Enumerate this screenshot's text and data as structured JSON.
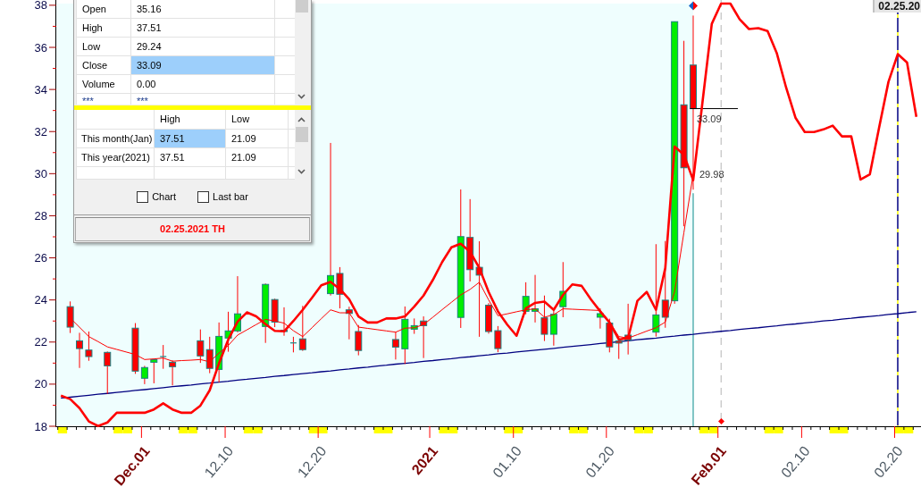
{
  "chart": {
    "chart_data": {
      "type": "candlestick",
      "ylim": [
        18,
        38.25
      ],
      "yticks": [
        18,
        20,
        22,
        24,
        26,
        28,
        30,
        32,
        34,
        36,
        38
      ],
      "categories": [
        null,
        null,
        null,
        null,
        null,
        null,
        null,
        null,
        null,
        "Dec.01",
        null,
        null,
        null,
        null,
        null,
        null,
        null,
        null,
        "12.10",
        null,
        null,
        null,
        null,
        null,
        null,
        null,
        null,
        null,
        "12.20",
        null,
        null,
        null,
        null,
        null,
        null,
        null,
        null,
        null,
        null,
        null,
        "2021",
        null,
        null,
        null,
        null,
        null,
        null,
        null,
        null,
        "01.10",
        null,
        null,
        null,
        null,
        null,
        null,
        null,
        null,
        null,
        "01.20",
        null,
        null,
        null,
        null,
        null,
        null,
        null,
        null,
        null,
        null,
        null,
        "Feb.01",
        null,
        null,
        null,
        null,
        null,
        null,
        null,
        null,
        "02.10",
        null,
        null,
        null,
        null,
        null,
        null,
        null,
        null,
        null,
        "02.20",
        null,
        null
      ],
      "ohlc": [
        null,
        [
          23.68,
          23.93,
          22.43,
          22.71
        ],
        [
          22.06,
          22.44,
          20.77,
          21.69
        ],
        [
          21.62,
          22.5,
          21.11,
          21.31
        ],
        null,
        [
          21.51,
          21.55,
          19.54,
          20.87
        ],
        null,
        null,
        [
          22.66,
          22.9,
          20.49,
          20.62
        ],
        [
          20.28,
          20.87,
          20.0,
          20.79
        ],
        [
          21.04,
          21.2,
          20.04,
          21.16
        ],
        [
          21.31,
          21.86,
          20.73,
          21.31
        ],
        [
          21.04,
          21.13,
          19.94,
          20.83
        ],
        null,
        null,
        [
          22.06,
          22.6,
          21.01,
          21.34
        ],
        [
          21.64,
          22.25,
          20.52,
          20.75
        ],
        [
          20.7,
          22.93,
          20.08,
          22.27
        ],
        [
          22.19,
          23.44,
          21.54,
          22.53
        ],
        [
          22.53,
          25.13,
          22.46,
          23.34
        ],
        null,
        null,
        [
          22.74,
          24.78,
          21.96,
          24.74
        ],
        [
          24.02,
          24.06,
          22.71,
          22.95
        ],
        [
          22.56,
          23.65,
          22.3,
          22.5
        ],
        [
          21.96,
          22.25,
          21.51,
          21.96
        ],
        [
          22.15,
          23.72,
          21.58,
          21.64
        ],
        null,
        null,
        [
          24.3,
          31.46,
          24.21,
          25.16
        ],
        [
          25.26,
          25.56,
          23.6,
          24.27
        ],
        [
          23.53,
          23.68,
          22.13,
          23.36
        ],
        [
          22.5,
          22.81,
          21.37,
          21.6
        ],
        null,
        null,
        null,
        [
          22.12,
          22.47,
          21.17,
          21.76
        ],
        [
          21.68,
          23.69,
          20.96,
          23.08
        ],
        [
          22.61,
          23.12,
          22.39,
          22.78
        ],
        [
          23.0,
          23.22,
          21.24,
          22.78
        ],
        null,
        null,
        null,
        [
          23.17,
          29.25,
          22.67,
          27.01
        ],
        [
          26.97,
          28.79,
          24.88,
          25.44
        ],
        [
          25.55,
          26.79,
          22.25,
          25.18
        ],
        [
          23.75,
          23.85,
          22.4,
          22.5
        ],
        [
          22.54,
          22.76,
          21.52,
          21.69
        ],
        null,
        null,
        [
          23.46,
          24.84,
          23.32,
          24.17
        ],
        [
          23.46,
          25.19,
          22.93,
          23.58
        ],
        [
          23.15,
          24.21,
          22.05,
          22.37
        ],
        [
          22.37,
          23.5,
          21.83,
          23.32
        ],
        [
          23.68,
          25.8,
          23.18,
          24.41
        ],
        null,
        null,
        null,
        [
          23.18,
          23.6,
          22.64,
          23.35
        ],
        [
          22.9,
          23.11,
          21.51,
          21.77
        ],
        [
          22.05,
          22.26,
          21.2,
          21.95
        ],
        [
          22.33,
          23.82,
          21.41,
          22.09
        ],
        null,
        null,
        [
          22.47,
          26.65,
          22.26,
          23.29
        ],
        [
          23.99,
          26.8,
          22.68,
          23.18
        ],
        [
          23.96,
          37.22,
          23.82,
          37.22
        ],
        [
          33.27,
          36.31,
          27.5,
          30.28
        ],
        [
          35.16,
          37.51,
          29.24,
          33.09
        ],
        null,
        null,
        null,
        null,
        null,
        null,
        null,
        null,
        null,
        null,
        null,
        null,
        null,
        null,
        null,
        null,
        null,
        null,
        null,
        null,
        null,
        null,
        null,
        null
      ],
      "series": [
        {
          "type": "line",
          "color": "#000080",
          "values": [
            19.34,
            19.38,
            19.43,
            19.47,
            19.52,
            19.56,
            19.61,
            19.65,
            19.7,
            19.74,
            19.79,
            19.83,
            19.88,
            19.92,
            19.96,
            20.01,
            20.05,
            20.1,
            20.14,
            20.19,
            20.23,
            20.28,
            20.32,
            20.37,
            20.41,
            20.46,
            20.5,
            20.54,
            20.59,
            20.63,
            20.68,
            20.72,
            20.77,
            20.81,
            20.86,
            20.9,
            20.95,
            20.99,
            21.03,
            21.08,
            21.12,
            21.17,
            21.21,
            21.26,
            21.3,
            21.35,
            21.39,
            21.44,
            21.48,
            21.53,
            21.57,
            21.61,
            21.66,
            21.7,
            21.75,
            21.79,
            21.84,
            21.88,
            21.93,
            21.97,
            22.02,
            22.06,
            22.11,
            22.15,
            22.19,
            22.24,
            22.28,
            22.33,
            22.37,
            22.42,
            22.46,
            22.51,
            22.55,
            22.6,
            22.64,
            22.68,
            22.73,
            22.77,
            22.82,
            22.86,
            22.91,
            22.95,
            23.0,
            23.04,
            23.09,
            23.13,
            23.18,
            23.22,
            23.26,
            23.31,
            23.35,
            23.4,
            23.44
          ]
        },
        {
          "type": "line",
          "color": "#ff0000",
          "values": [
            19.45,
            19.29,
            18.86,
            18.23,
            18.01,
            18.18,
            18.64,
            18.64,
            18.64,
            18.64,
            18.8,
            19.09,
            18.8,
            18.64,
            18.64,
            18.98,
            19.71,
            20.99,
            22.12,
            22.97,
            23.41,
            23.22,
            22.85,
            22.53,
            22.51,
            23.0,
            23.53,
            24.1,
            24.7,
            24.86,
            24.52,
            24.03,
            23.22,
            22.93,
            22.93,
            23.12,
            23.12,
            23.22,
            23.68,
            24.21,
            24.95,
            25.8,
            26.5,
            26.67,
            26.29,
            25.52,
            24.38,
            23.46,
            22.83,
            22.3,
            23.6,
            23.86,
            23.92,
            23.53,
            24.24,
            24.74,
            24.67,
            24.03,
            23.46,
            22.93,
            22.12,
            22.19,
            23.96,
            24.38,
            23.53,
            25.52,
            31.29,
            30.9,
            29.69,
            33.4,
            37.12,
            38.08,
            38.08,
            37.33,
            36.87,
            36.91,
            36.77,
            35.71,
            34.08,
            32.66,
            31.98,
            31.98,
            32.1,
            32.28,
            31.77,
            31.77,
            29.72,
            29.97,
            32.2,
            34.36,
            35.68,
            35.28,
            32.7
          ]
        },
        {
          "type": "line",
          "color": "#ff0000",
          "values": [
            null,
            23.14,
            22.7,
            22.26,
            22.02,
            21.77,
            21.65,
            21.53,
            21.41,
            21.17,
            21.2,
            21.24,
            21.09,
            21.12,
            21.14,
            21.17,
            21.06,
            21.48,
            21.84,
            22.33,
            22.58,
            22.83,
            23.08,
            23.0,
            22.9,
            22.54,
            22.26,
            22.68,
            23.11,
            23.53,
            23.39,
            23.39,
            22.71,
            22.65,
            22.59,
            22.53,
            22.47,
            22.66,
            22.68,
            22.83,
            23.18,
            23.54,
            23.89,
            24.24,
            24.5,
            24.84,
            24.0,
            23.25,
            23.34,
            23.44,
            23.53,
            23.58,
            23.18,
            23.3,
            23.58,
            23.56,
            23.54,
            23.52,
            23.5,
            22.97,
            22.26,
            22.19,
            22.35,
            22.52,
            22.68,
            22.95,
            24.4,
            27.2,
            29.98,
            null,
            null,
            null,
            null,
            null,
            null,
            null,
            null,
            null,
            null,
            null,
            null,
            null,
            null,
            null,
            null,
            null,
            null,
            null,
            null,
            null,
            null,
            null,
            null
          ]
        }
      ],
      "annotations": [
        "33.09",
        "29.98"
      ]
    },
    "cursor_label": "02.25.20"
  },
  "data_window": {
    "quote_rows": [
      {
        "label": "Open",
        "value": "35.16",
        "selected": false,
        "kind": "data"
      },
      {
        "label": "High",
        "value": "37.51",
        "selected": false,
        "kind": "data"
      },
      {
        "label": "Low",
        "value": "29.24",
        "selected": false,
        "kind": "data"
      },
      {
        "label": "Close",
        "value": "33.09",
        "selected": true,
        "kind": "data"
      },
      {
        "label": "Volume",
        "value": "0.00",
        "selected": false,
        "kind": "data"
      },
      {
        "label": "***",
        "value": "***",
        "selected": false,
        "kind": "filler"
      }
    ],
    "range_table": {
      "columns": [
        "High",
        "Low"
      ],
      "rows": [
        {
          "label": "This month(Jan)",
          "cells": [
            {
              "value": "37.51",
              "selected": true
            },
            {
              "value": "21.09",
              "selected": false
            }
          ]
        },
        {
          "label": "This year(2021)",
          "cells": [
            {
              "value": "37.51",
              "selected": false
            },
            {
              "value": "21.09",
              "selected": false
            }
          ]
        }
      ]
    },
    "checkboxes": [
      {
        "label": "Chart",
        "checked": false
      },
      {
        "label": "Last bar",
        "checked": false
      }
    ],
    "status": "02.25.2021 TH"
  }
}
